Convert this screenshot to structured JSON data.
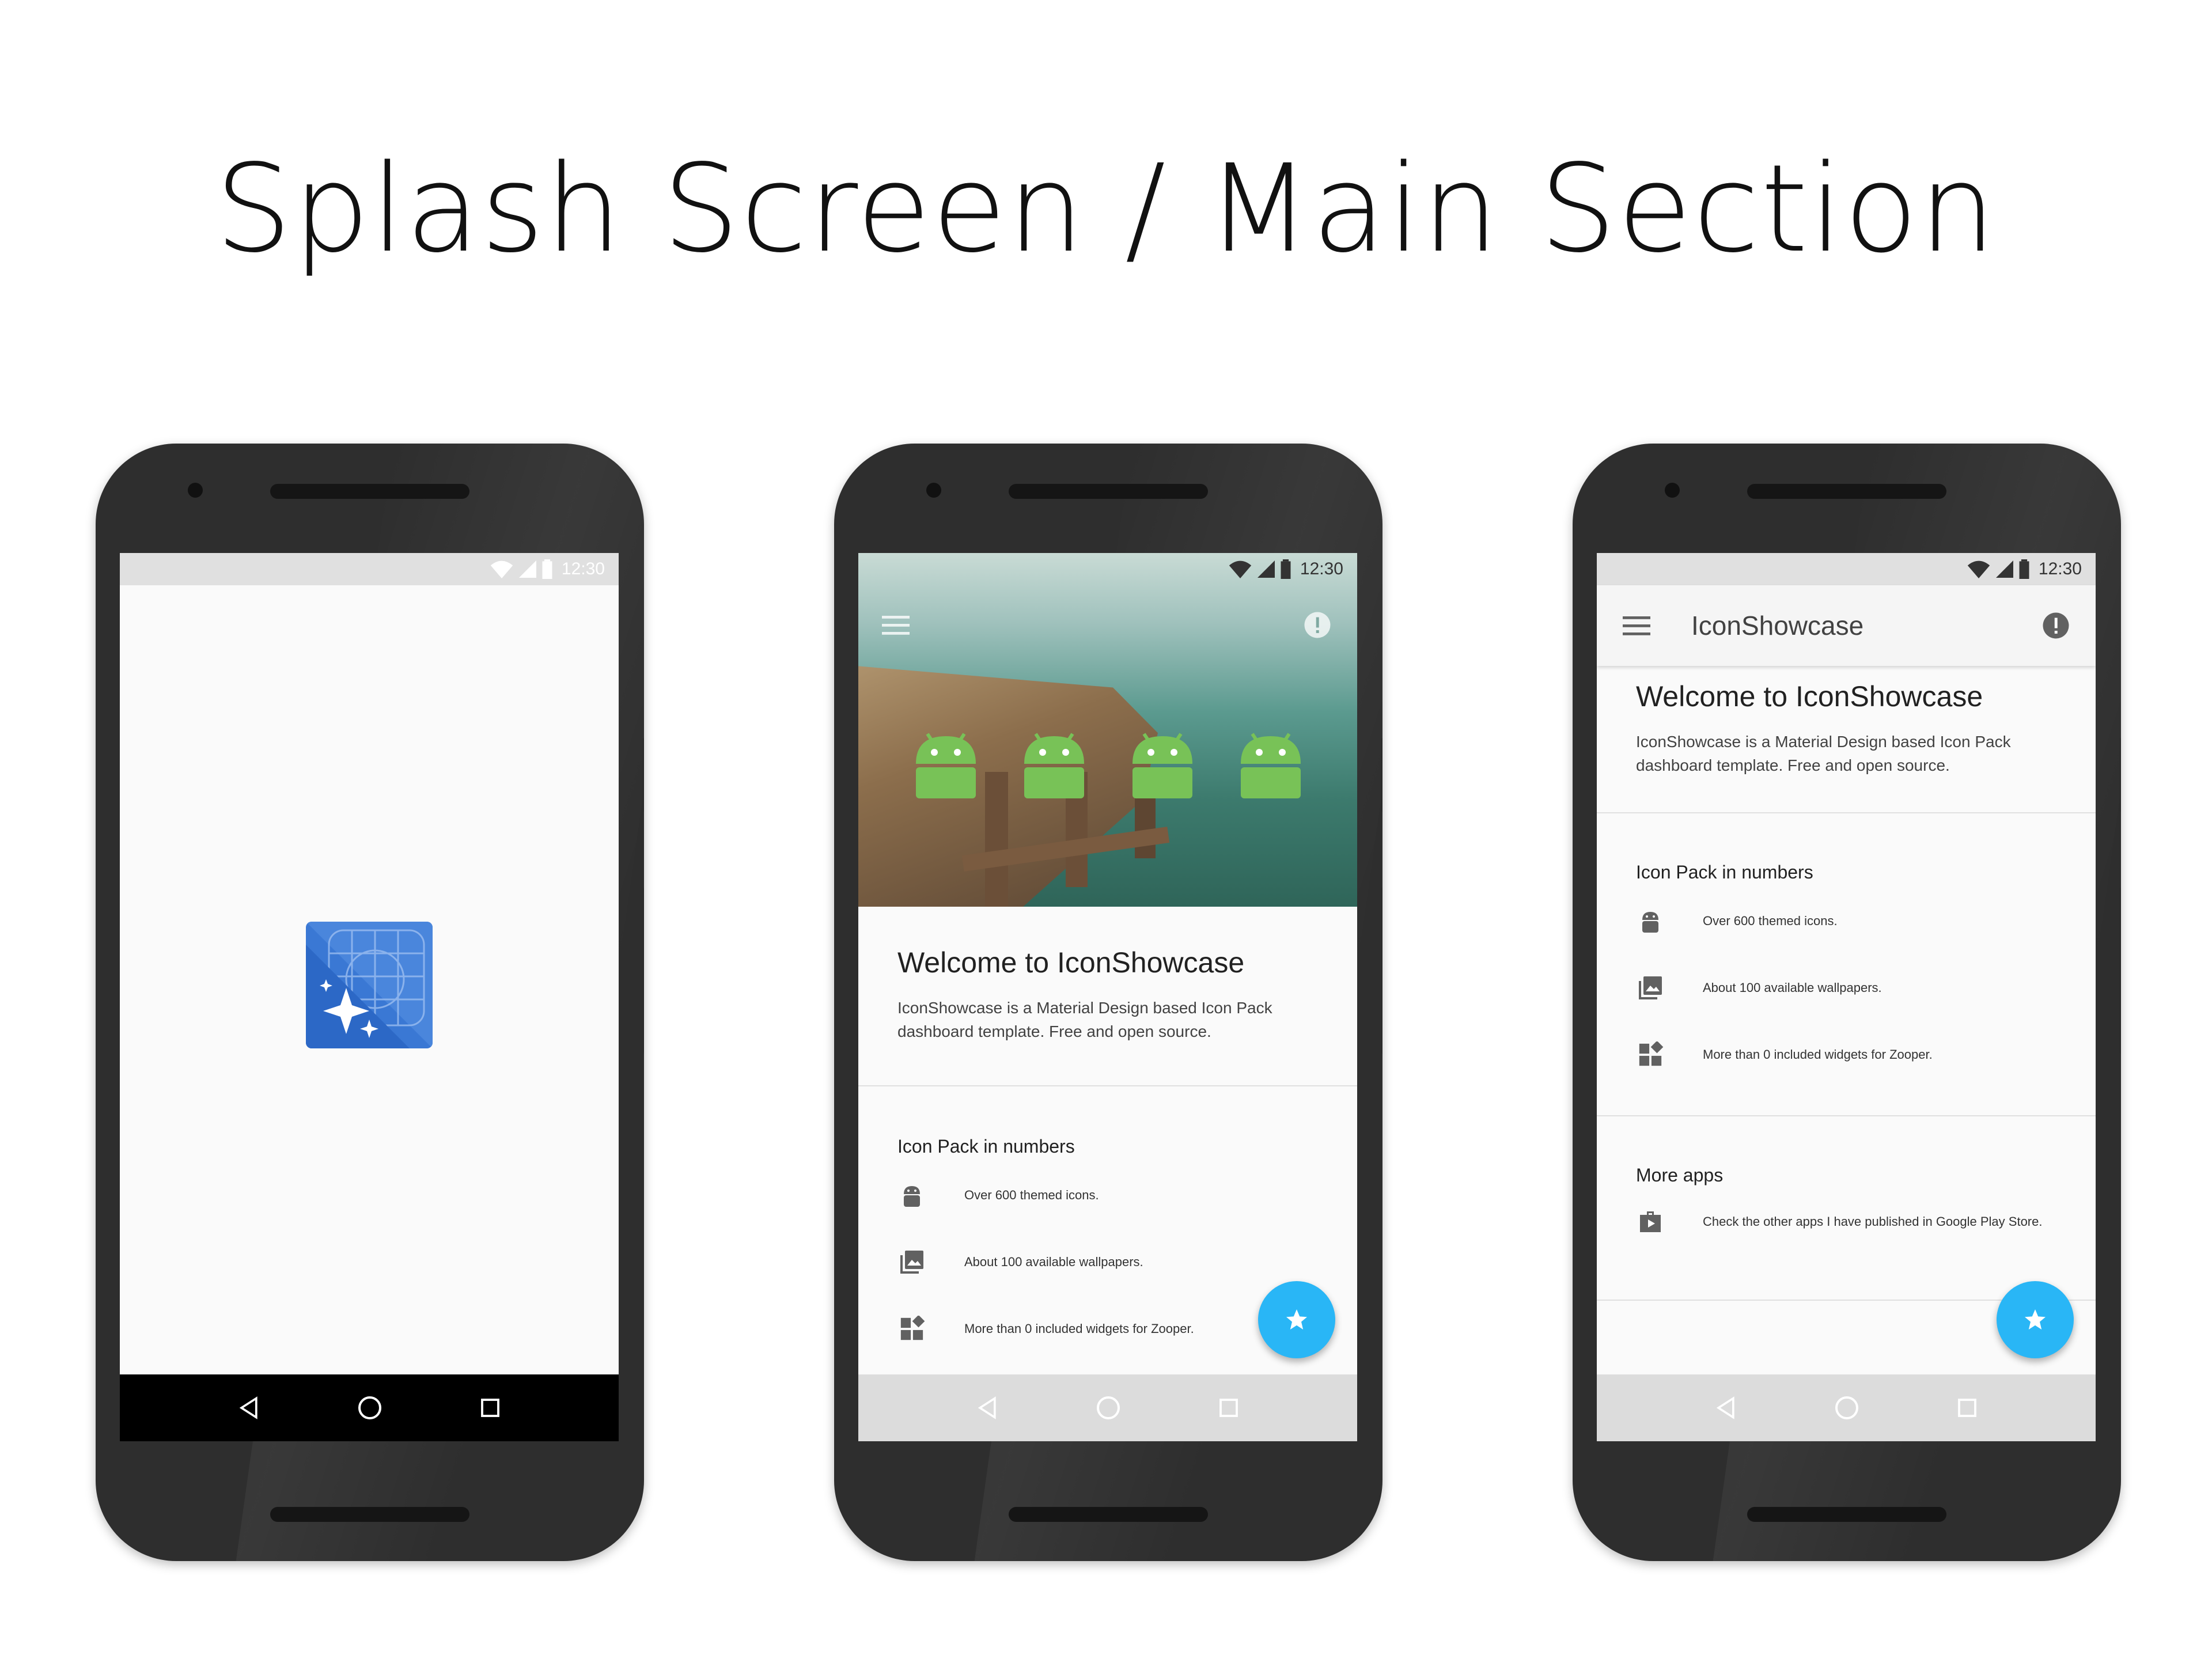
{
  "page": {
    "title": "Splash Screen / Main Section"
  },
  "status": {
    "time": "12:30"
  },
  "app": {
    "name": "IconShowcase",
    "welcome_title": "Welcome to IconShowcase",
    "welcome_body": "IconShowcase is a Material Design based Icon Pack dashboard template. Free and open source.",
    "numbers_title": "Icon Pack in numbers",
    "stats": [
      {
        "icon": "android-icon",
        "text": "Over 600 themed icons."
      },
      {
        "icon": "wallpapers-icon",
        "text": "About 100 available wallpapers."
      },
      {
        "icon": "widgets-icon",
        "text": "More than 0 included widgets for Zooper."
      }
    ],
    "more_apps_title": "More apps",
    "more_apps_text": "Check the other apps I have published in Google Play Store."
  },
  "colors": {
    "fab": "#29b6f6",
    "droid": "#78c257",
    "splash_blue": "#3a78d4"
  }
}
